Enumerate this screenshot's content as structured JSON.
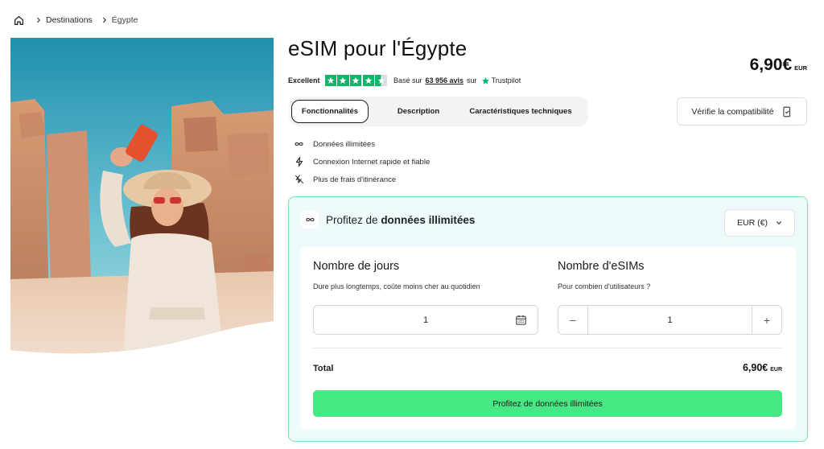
{
  "breadcrumb": {
    "home_icon": "home-icon",
    "items": [
      "Destinations",
      "Égypte"
    ]
  },
  "product": {
    "title": "eSIM pour l'Égypte",
    "price": "6,90€",
    "currency_code": "EUR"
  },
  "rating": {
    "label": "Excellent",
    "stars": 4.5,
    "based_on": "Basé sur",
    "reviews": "63 956 avis",
    "on": "sur",
    "provider": "Trustpilot",
    "star_color": "#17b26a"
  },
  "tabs": [
    {
      "label": "Fonctionnalités",
      "active": true
    },
    {
      "label": "Description",
      "active": false
    },
    {
      "label": "Caractéristiques techniques",
      "active": false
    }
  ],
  "compatibility": {
    "label": "Vérifie la compatibilité",
    "icon": "phone-check-icon"
  },
  "features": [
    {
      "icon": "infinity-icon",
      "label": "Données illimitées"
    },
    {
      "icon": "bolt-icon",
      "label": "Connexion Internet rapide et fiable"
    },
    {
      "icon": "no-roaming-icon",
      "label": "Plus de frais d'itinérance"
    }
  ],
  "plan": {
    "prefix": "Profitez de",
    "highlight": "données illimitées",
    "currency_select": "EUR (€)",
    "border_color": "#78e3a7",
    "background_color": "#eefafb"
  },
  "days": {
    "title": "Nombre de jours",
    "subtitle": "Dure plus longtemps, coûte moins cher au quotidien",
    "value": "1"
  },
  "esims": {
    "title": "Nombre d'eSIMs",
    "subtitle": "Pour combien d'utilisateurs ?",
    "value": "1",
    "minus": "−",
    "plus": "+"
  },
  "total": {
    "label": "Total",
    "price": "6,90€",
    "currency_code": "EUR"
  },
  "cta": {
    "label": "Profitez de données illimitées",
    "color": "#46e883"
  }
}
